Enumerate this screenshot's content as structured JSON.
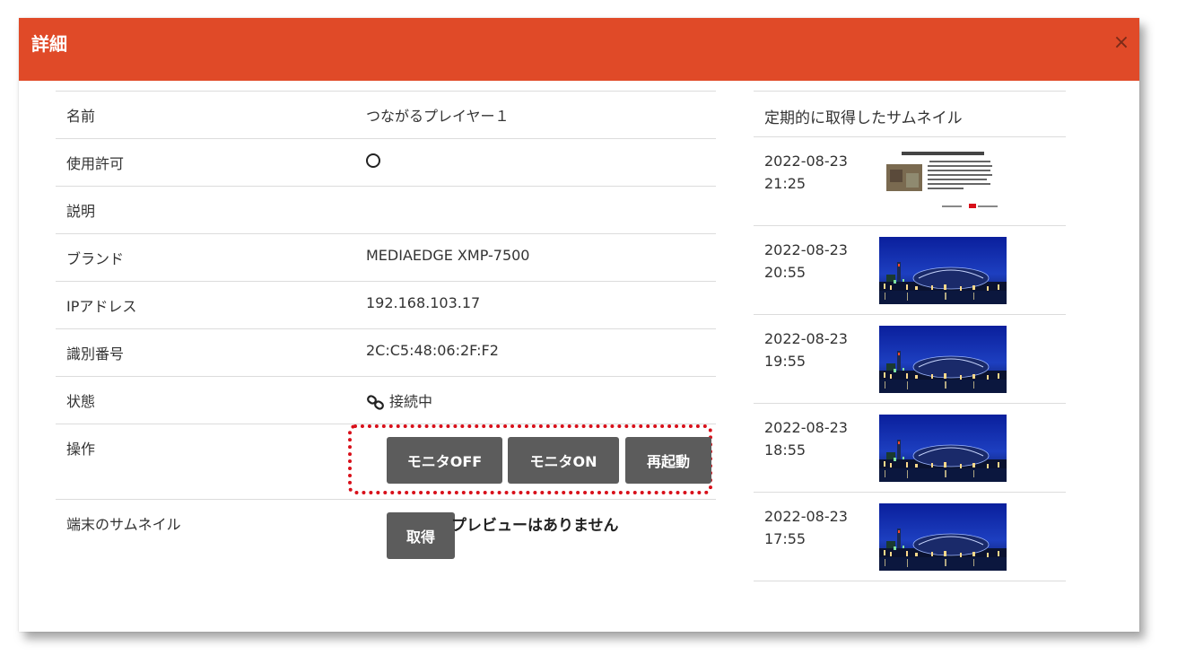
{
  "dialog": {
    "title": "詳細",
    "close_label": "×"
  },
  "info": {
    "name_label": "名前",
    "name_value": "つながるプレイヤー１",
    "permission_label": "使用許可",
    "description_label": "説明",
    "description_value": "",
    "brand_label": "ブランド",
    "brand_value": "MEDIAEDGE XMP-7500",
    "ip_label": "IPアドレス",
    "ip_value": "192.168.103.17",
    "id_label": "識別番号",
    "id_value": "2C:C5:48:06:2F:F2",
    "status_label": "状態",
    "status_value": "接続中",
    "operation_label": "操作",
    "buttons": {
      "monitor_off": "モニタOFF",
      "monitor_on": "モニタON",
      "restart": "再起動"
    },
    "thumbnail_label": "端末のサムネイル",
    "fetch_button": "取得",
    "no_preview": "プレビューはありません"
  },
  "thumbnails": {
    "header": "定期的に取得したサムネイル",
    "items": [
      {
        "date": "2022-08-23",
        "time": "21:25",
        "image": "document-slide"
      },
      {
        "date": "2022-08-23",
        "time": "20:55",
        "image": "night-city"
      },
      {
        "date": "2022-08-23",
        "time": "19:55",
        "image": "night-city"
      },
      {
        "date": "2022-08-23",
        "time": "18:55",
        "image": "night-city"
      },
      {
        "date": "2022-08-23",
        "time": "17:55",
        "image": "night-city"
      }
    ]
  },
  "colors": {
    "header": "#e04a28",
    "button": "#5c5c5c",
    "highlight": "#d8101a"
  }
}
